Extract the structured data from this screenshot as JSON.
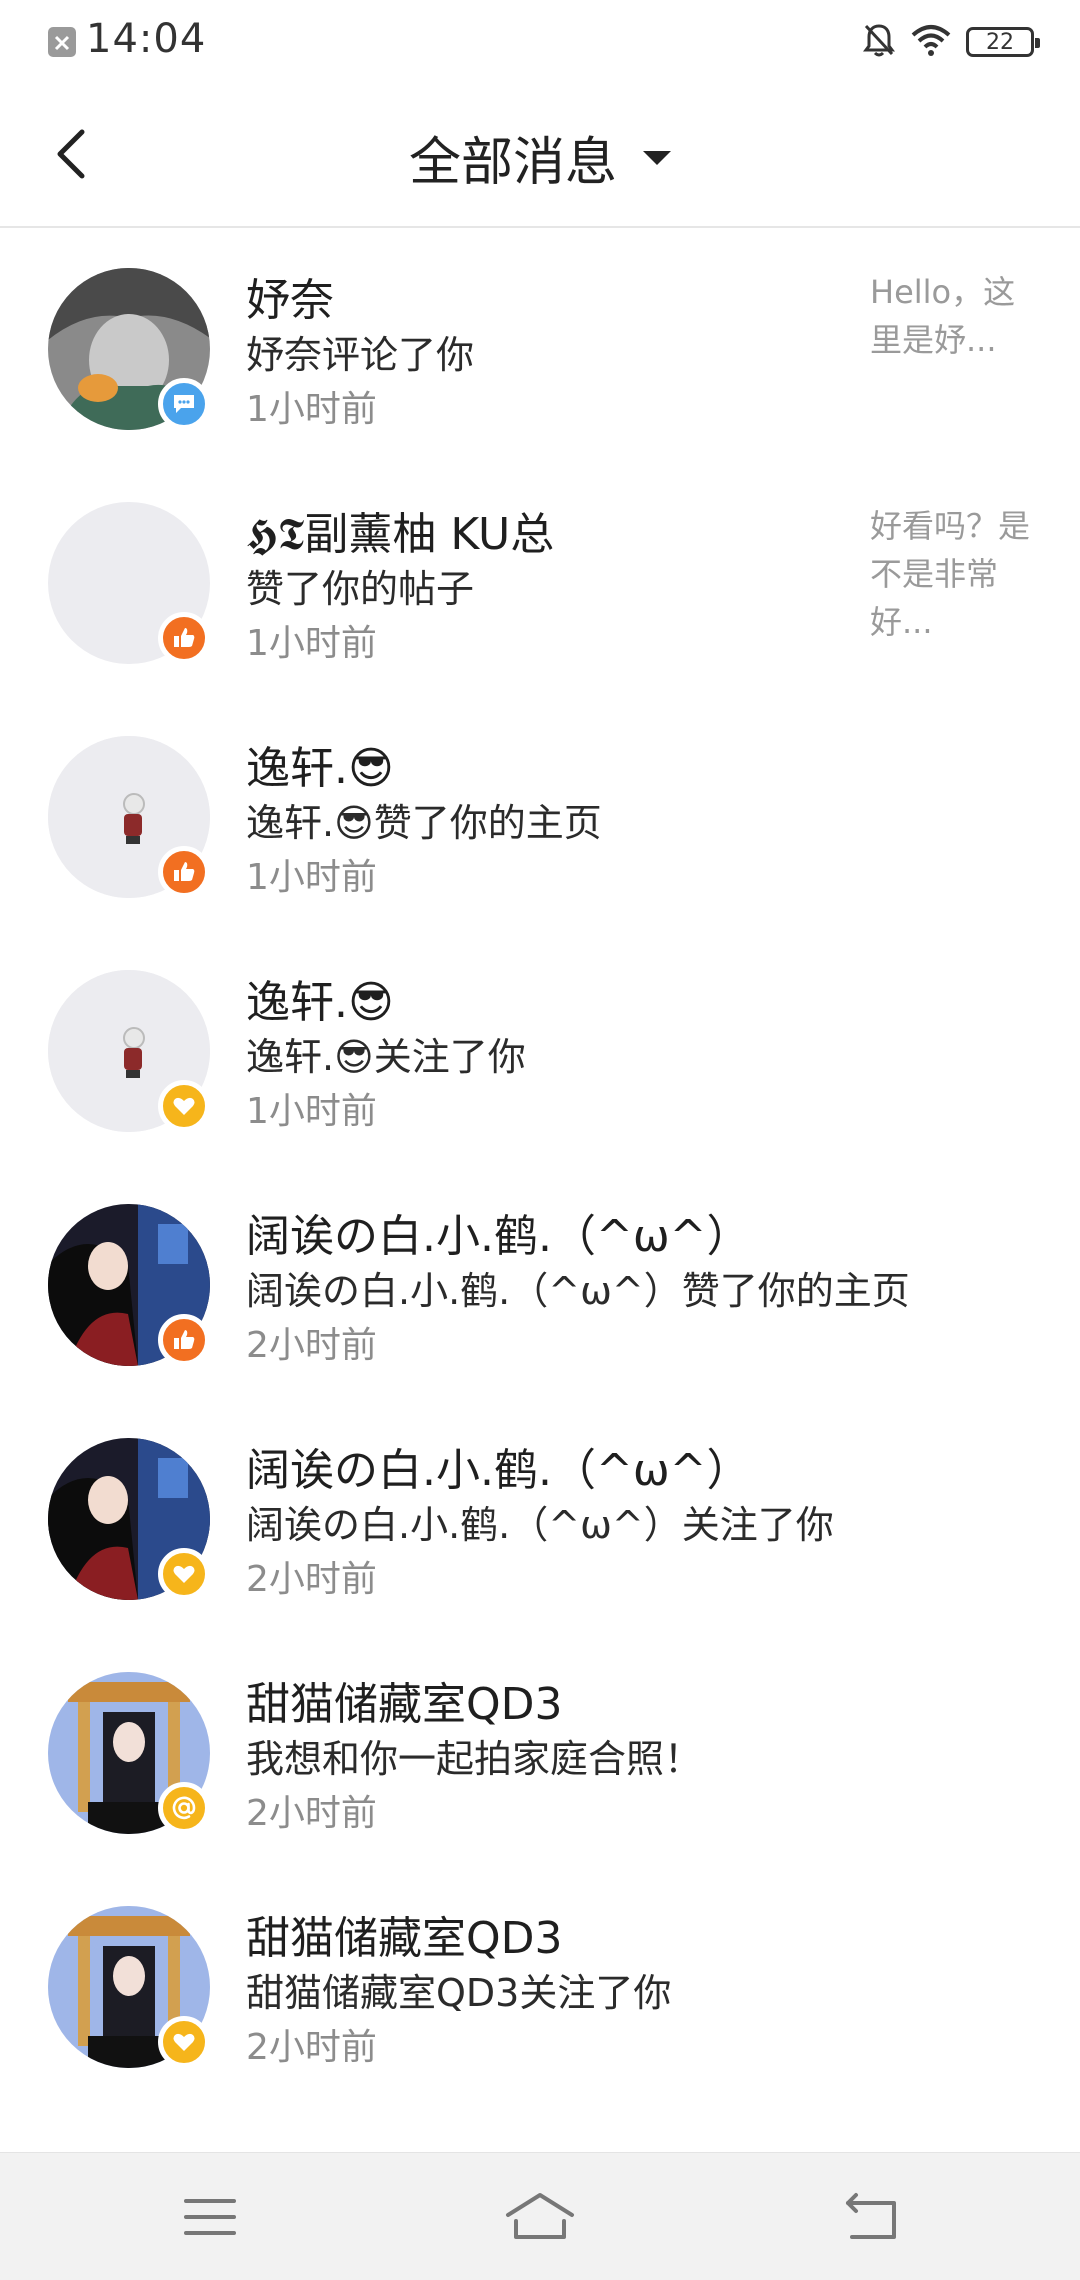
{
  "status_bar": {
    "time": "14:04",
    "battery": "22",
    "icons": [
      "notification-blocked-icon",
      "bell-off-icon",
      "wifi-icon",
      "battery-icon"
    ]
  },
  "header": {
    "title": "全部消息",
    "back_icon": "chevron-left-icon",
    "dropdown_icon": "caret-down-icon"
  },
  "messages": [
    {
      "name": "妤奈",
      "action": "妤奈评论了你",
      "time": "1小时前",
      "preview": "Hello，这里是妤...",
      "badge": "comment",
      "badge_color": "#4aa3ec"
    },
    {
      "name": "𝕳𝕿副薰柚 KU总",
      "action": "赞了你的帖子",
      "time": "1小时前",
      "preview": "好看吗？是不是非常好...",
      "badge": "like",
      "badge_color": "#f26f21"
    },
    {
      "name": "逸轩.😎",
      "action": "逸轩.😎赞了你的主页",
      "time": "1小时前",
      "preview": "",
      "badge": "like",
      "badge_color": "#f26f21"
    },
    {
      "name": "逸轩.😎",
      "action": "逸轩.😎关注了你",
      "time": "1小时前",
      "preview": "",
      "badge": "heart",
      "badge_color": "#f6b51b"
    },
    {
      "name": "阔诶の白.小.鹤.（^ω^）",
      "action": "阔诶の白.小.鹤.（^ω^）赞了你的主页",
      "time": "2小时前",
      "preview": "",
      "badge": "like",
      "badge_color": "#f26f21"
    },
    {
      "name": "阔诶の白.小.鹤.（^ω^）",
      "action": "阔诶の白.小.鹤.（^ω^）关注了你",
      "time": "2小时前",
      "preview": "",
      "badge": "heart",
      "badge_color": "#f6b51b"
    },
    {
      "name": "甜猫储藏室QD3",
      "action": "我想和你一起拍家庭合照！",
      "time": "2小时前",
      "preview": "",
      "badge": "at",
      "badge_color": "#f6b51b"
    },
    {
      "name": "甜猫储藏室QD3",
      "action": "甜猫储藏室QD3关注了你",
      "time": "2小时前",
      "preview": "",
      "badge": "heart",
      "badge_color": "#f6b51b"
    }
  ],
  "nav_bar": {
    "icons": [
      "menu-icon",
      "home-icon",
      "back-icon"
    ]
  }
}
